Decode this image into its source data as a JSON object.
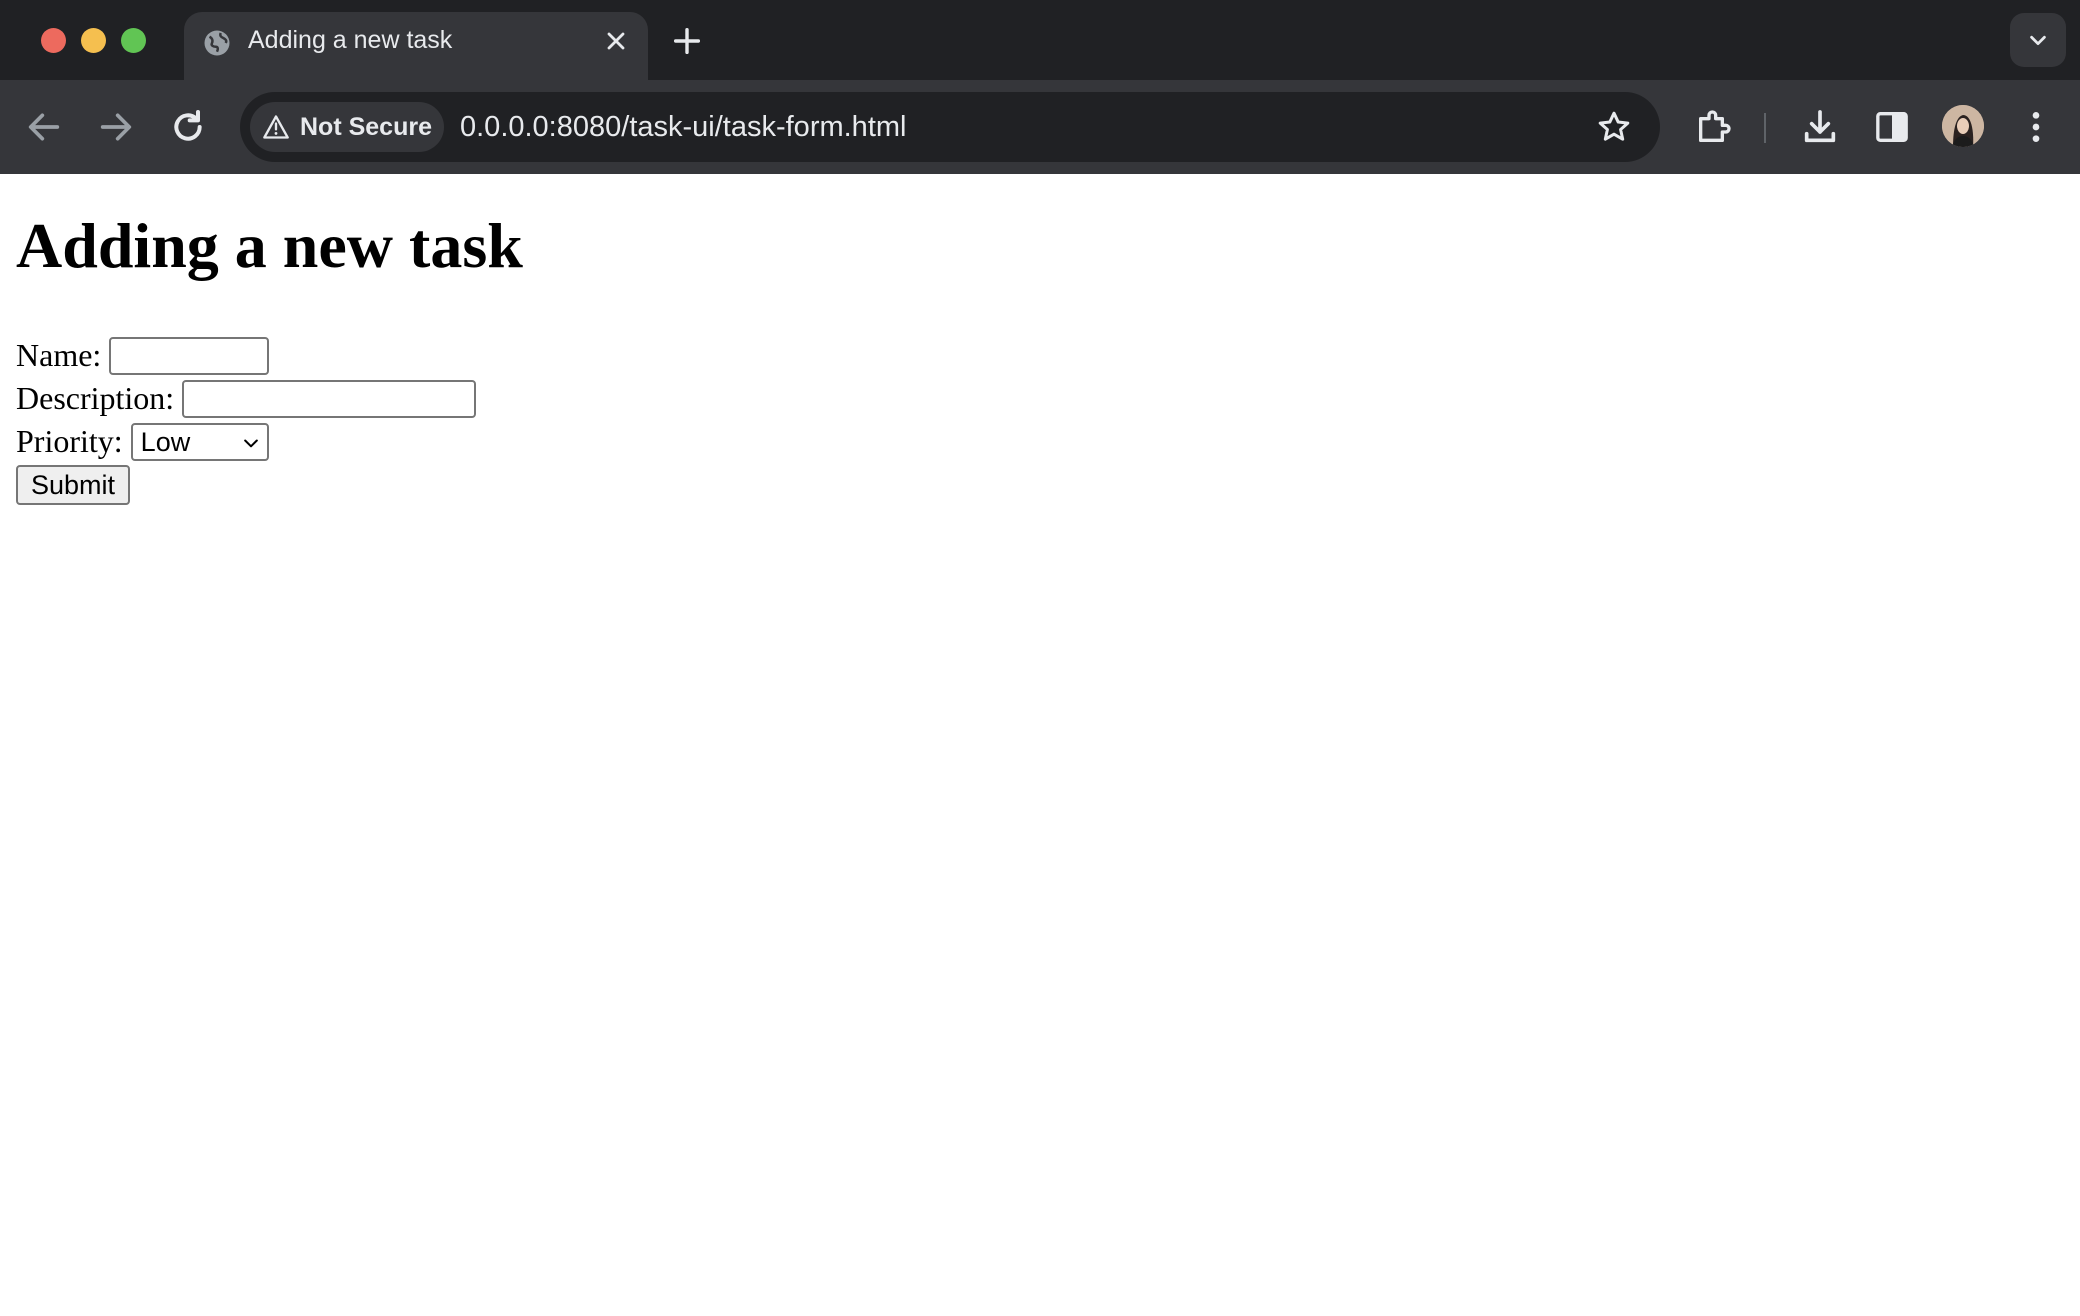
{
  "browser": {
    "tab_title": "Adding a new task",
    "security_label": "Not Secure",
    "url": "0.0.0.0:8080/task-ui/task-form.html",
    "icons": {
      "tab_favicon": "globe-icon",
      "tab_close": "close-icon",
      "new_tab": "plus-icon",
      "tab_search": "chevron-down-icon",
      "back": "back-arrow-icon",
      "forward": "forward-arrow-icon",
      "reload": "reload-icon",
      "warning": "warning-triangle-icon",
      "bookmark": "star-icon",
      "extensions": "puzzle-piece-icon",
      "downloads": "download-icon",
      "side_panel": "side-panel-icon",
      "profile": "avatar",
      "menu": "kebab-menu-icon"
    }
  },
  "page": {
    "heading": "Adding a new task",
    "form": {
      "name_label": "Name:",
      "name_value": "",
      "description_label": "Description:",
      "description_value": "",
      "priority_label": "Priority:",
      "priority_selected": "Low",
      "submit_label": "Submit"
    }
  }
}
